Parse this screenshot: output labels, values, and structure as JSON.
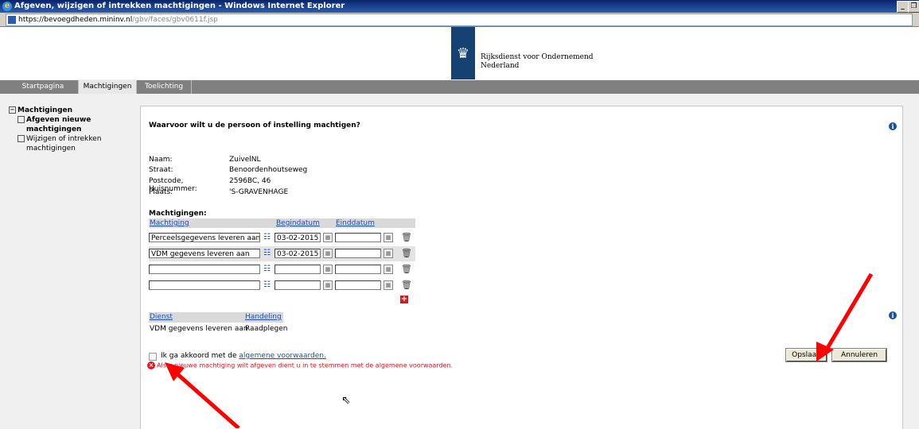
{
  "window": {
    "title": "Afgeven, wijzigen of intrekken machtigingen - Windows Internet Explorer",
    "url_host": "https://bevoegdheden.mininv.nl",
    "url_path": "/gbv/faces/gbv0611f.jsp"
  },
  "header": {
    "org_line1": "Rijksdienst voor Ondernemend",
    "org_line2": "Nederland"
  },
  "nav": {
    "tabs": [
      {
        "label": "Startpagina"
      },
      {
        "label": "Machtigingen"
      },
      {
        "label": "Toelichting"
      }
    ]
  },
  "sidebar": {
    "root": "Machtigingen",
    "items": [
      {
        "line1": "Afgeven nieuwe",
        "line2": "machtigingen"
      },
      {
        "line1": "Wijzigen of intrekken",
        "line2": "machtigingen"
      }
    ]
  },
  "main": {
    "question": "Waarvoor wilt u de persoon of instelling machtigen?",
    "details": [
      {
        "label": "Naam:",
        "value": "ZuivelNL"
      },
      {
        "label": "Straat:",
        "value": "Benoordenhoutseweg"
      },
      {
        "label": "Postcode, Huisnummer:",
        "value": "2596BC, 46"
      },
      {
        "label": "Plaats:",
        "value": "'S-GRAVENHAGE"
      }
    ],
    "machtigingen_title": "Machtigingen:",
    "grid_headers": {
      "machtiging": "Machtiging",
      "begindatum": "Begindatum",
      "einddatum": "Einddatum"
    },
    "rows": [
      {
        "machtiging": "Perceelsgegevens leveren aan",
        "begindatum": "03-02-2015",
        "einddatum": ""
      },
      {
        "machtiging": "VDM gegevens leveren aan",
        "begindatum": "03-02-2015",
        "einddatum": ""
      },
      {
        "machtiging": "",
        "begindatum": "",
        "einddatum": ""
      },
      {
        "machtiging": "",
        "begindatum": "",
        "einddatum": ""
      }
    ],
    "grid2_headers": {
      "dienst": "Dienst",
      "handeling": "Handeling"
    },
    "grid2_row": {
      "dienst": "VDM gegevens leveren aan",
      "handeling": "Raadplegen"
    },
    "agree_prefix": "Ik ga akkoord met de",
    "agree_link": "algemene voorwaarden.",
    "error_text": "Als u nieuwe machtiging wilt afgeven dient u in te stemmen met de algemene voorwaarden.",
    "save_label": "Opslaan",
    "cancel_label": "Annuleren"
  },
  "colors": {
    "accent": "#154273",
    "link": "#1f4ea8",
    "error": "#e0171b",
    "arrow": "#ff0000"
  }
}
